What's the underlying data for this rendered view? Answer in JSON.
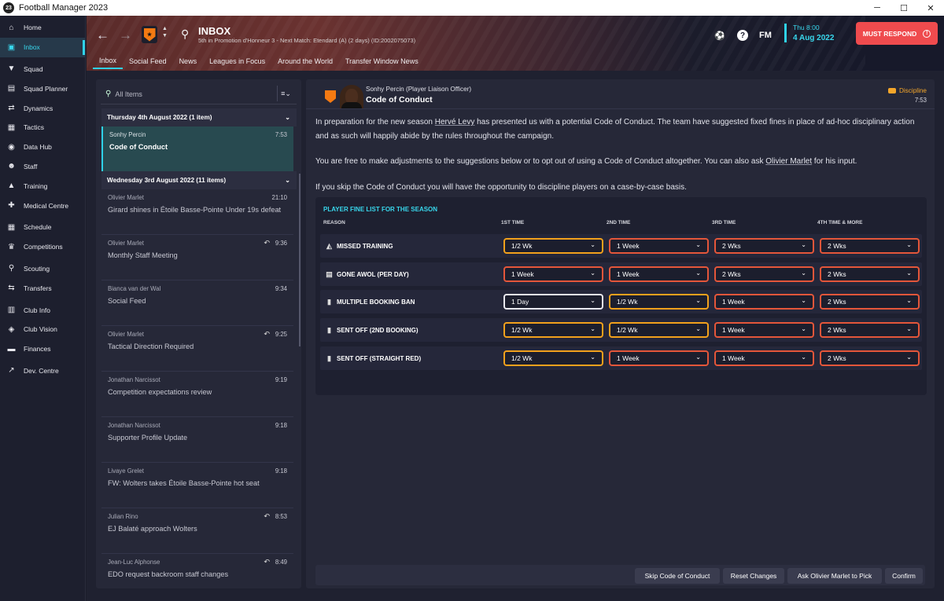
{
  "window": {
    "title": "Football Manager 2023",
    "app_icon": "23"
  },
  "sidebar": {
    "items": [
      {
        "label": "Home",
        "icon": "home-icon"
      },
      {
        "label": "Inbox",
        "icon": "inbox-icon"
      },
      {
        "label": "Squad",
        "icon": "shirt-icon"
      },
      {
        "label": "Squad Planner",
        "icon": "planner-icon"
      },
      {
        "label": "Dynamics",
        "icon": "dynamics-icon"
      },
      {
        "label": "Tactics",
        "icon": "tactics-icon"
      },
      {
        "label": "Data Hub",
        "icon": "data-hub-icon"
      },
      {
        "label": "Staff",
        "icon": "staff-icon"
      },
      {
        "label": "Training",
        "icon": "training-icon"
      },
      {
        "label": "Medical Centre",
        "icon": "medical-icon"
      },
      {
        "label": "Schedule",
        "icon": "calendar-icon"
      },
      {
        "label": "Competitions",
        "icon": "trophy-icon"
      },
      {
        "label": "Scouting",
        "icon": "scouting-icon"
      },
      {
        "label": "Transfers",
        "icon": "transfers-icon"
      },
      {
        "label": "Club Info",
        "icon": "club-info-icon"
      },
      {
        "label": "Club Vision",
        "icon": "club-vision-icon"
      },
      {
        "label": "Finances",
        "icon": "finances-icon"
      },
      {
        "label": "Dev. Centre",
        "icon": "dev-centre-icon"
      }
    ]
  },
  "header": {
    "title": "INBOX",
    "subtitle": "5th in Promotion d'Honneur 3 - Next Match: Etendard (A) (2 days) (ID:2002075073)",
    "tabs": [
      "Inbox",
      "Social Feed",
      "News",
      "Leagues in Focus",
      "Around the World",
      "Transfer Window News"
    ],
    "fm_label": "FM",
    "date_day": "Thu 8:00",
    "date_full": "4 Aug 2022",
    "must_respond": "MUST RESPOND",
    "accent": "#2fd2e8",
    "alert_color": "#ef4b4e"
  },
  "list": {
    "search_placeholder": "All Items",
    "groups": [
      {
        "label": "Thursday 4th August 2022 (1 item)"
      },
      {
        "label": "Wednesday 3rd August 2022 (11 items)"
      }
    ],
    "messages": [
      {
        "from": "Sonhy Percin",
        "subject": "Code of Conduct",
        "time": "7:53"
      },
      {
        "from": "Olivier Marlet",
        "subject": "Girard shines in Étoile Basse-Pointe Under 19s defeat",
        "time": "21:10"
      },
      {
        "from": "Olivier Marlet",
        "subject": "Monthly Staff Meeting",
        "time": "9:36"
      },
      {
        "from": "Bianca van der Wal",
        "subject": "Social Feed",
        "time": "9:34"
      },
      {
        "from": "Olivier Marlet",
        "subject": "Tactical Direction Required",
        "time": "9:25"
      },
      {
        "from": "Jonathan Narcissot",
        "subject": "Competition expectations review",
        "time": "9:19"
      },
      {
        "from": "Jonathan Narcissot",
        "subject": "Supporter Profile Update",
        "time": "9:18"
      },
      {
        "from": "Livaye Grelet",
        "subject": "FW: Wolters takes Étoile Basse-Pointe hot seat",
        "time": "9:18"
      },
      {
        "from": "Julian Rino",
        "subject": "EJ Balaté approach Wolters",
        "time": "8:53"
      },
      {
        "from": "Jean-Luc Alphonse",
        "subject": "EDO request backroom staff changes",
        "time": "8:49"
      }
    ]
  },
  "detail": {
    "sender": "Sonhy Percin  (Player Liaison Officer)",
    "subject": "Code of Conduct",
    "category": "Discipline",
    "time": "7:53",
    "p1_a": "In preparation for the new season ",
    "p1_name": "Hervé Levy",
    "p1_b": " has presented us with a potential Code of Conduct. The team have suggested fixed fines in place of ad-hoc disciplinary action and as such will happily abide by the rules throughout the campaign.",
    "p2_a": "You are free to make adjustments to the suggestions below or to opt out of using a Code of Conduct altogether. You can also ask ",
    "p2_name": "Olivier Marlet",
    "p2_b": " for his input.",
    "p3": "If you skip the Code of Conduct you will have the opportunity to discipline players on a case-by-case basis."
  },
  "fines": {
    "title": "PLAYER FINE LIST FOR THE SEASON",
    "columns": [
      "REASON",
      "1ST TIME",
      "2ND TIME",
      "3RD TIME",
      "4TH TIME & MORE"
    ],
    "rows": [
      {
        "reason": "MISSED TRAINING",
        "icon": "missed-training-icon",
        "values": [
          "1/2 Wk",
          "1 Week",
          "2 Wks",
          "2 Wks"
        ]
      },
      {
        "reason": "GONE AWOL (PER DAY)",
        "icon": "awol-icon",
        "values": [
          "1 Week",
          "1 Week",
          "2 Wks",
          "2 Wks"
        ]
      },
      {
        "reason": "MULTIPLE BOOKING BAN",
        "icon": "cards-icon",
        "values": [
          "1 Day",
          "1/2 Wk",
          "1 Week",
          "2 Wks"
        ]
      },
      {
        "reason": "SENT OFF (2ND BOOKING)",
        "icon": "second-yellow-icon",
        "values": [
          "1/2 Wk",
          "1/2 Wk",
          "1 Week",
          "2 Wks"
        ]
      },
      {
        "reason": "SENT OFF (STRAIGHT RED)",
        "icon": "red-card-icon",
        "values": [
          "1/2 Wk",
          "1 Week",
          "1 Week",
          "2 Wks"
        ]
      }
    ]
  },
  "footer": {
    "buttons": [
      "Skip Code of Conduct",
      "Reset Changes",
      "Ask Olivier Marlet to Pick",
      "Confirm"
    ]
  }
}
